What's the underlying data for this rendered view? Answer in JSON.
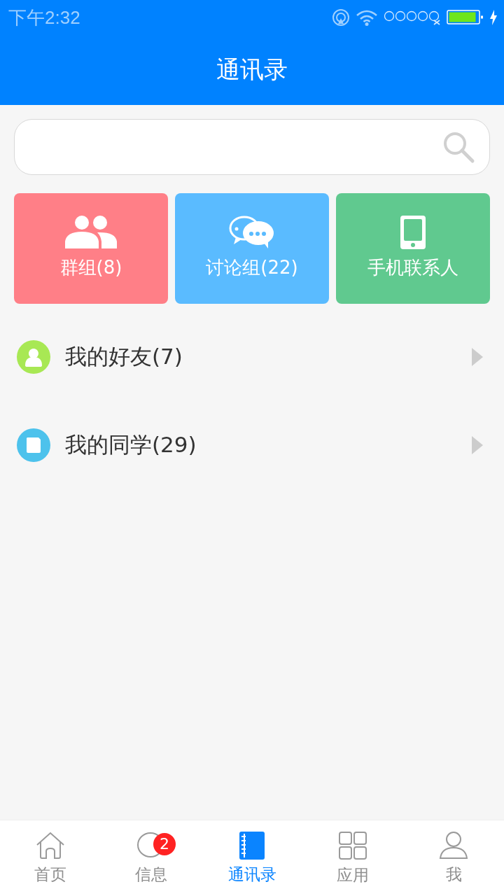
{
  "status_bar": {
    "time": "下午2:32"
  },
  "header": {
    "title": "通讯录"
  },
  "tiles": [
    {
      "kind": "group",
      "label": "群组(8)",
      "color": "#ff7f87"
    },
    {
      "kind": "discussion",
      "label": "讨论组(22)",
      "color": "#5abbff"
    },
    {
      "kind": "phone",
      "label": "手机联系人",
      "color": "#60c98f"
    }
  ],
  "lists": [
    {
      "kind": "friends",
      "label": "我的好友(7)",
      "color": "#a8e854"
    },
    {
      "kind": "classmates",
      "label": "我的同学(29)",
      "color": "#4dc2ec"
    }
  ],
  "tabs": [
    {
      "kind": "home",
      "label": "首页",
      "selected": false
    },
    {
      "kind": "messages",
      "label": "信息",
      "selected": false,
      "badge": "2"
    },
    {
      "kind": "contacts",
      "label": "通讯录",
      "selected": true
    },
    {
      "kind": "apps",
      "label": "应用",
      "selected": false
    },
    {
      "kind": "me",
      "label": "我",
      "selected": false
    }
  ]
}
